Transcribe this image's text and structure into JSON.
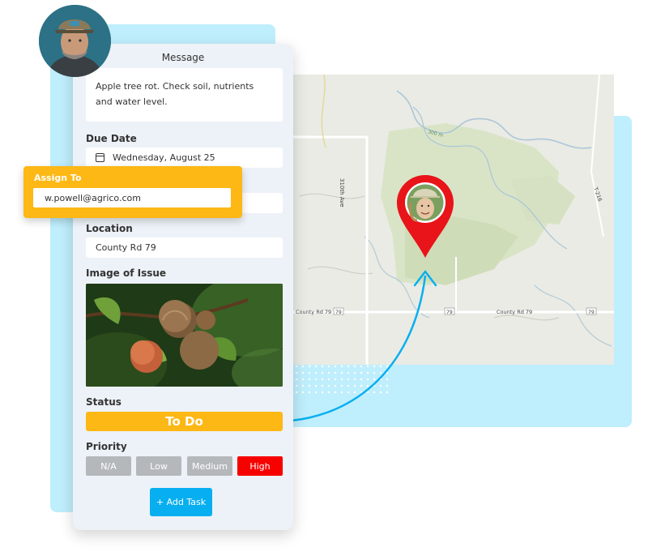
{
  "card": {
    "title": "Message",
    "message": "Apple tree rot. Check soil, nutrients and water level.",
    "due_date_label": "Due Date",
    "due_date_value": "Wednesday, August 25",
    "location_label": "Location",
    "location_value": "County Rd 79",
    "image_label": "Image of Issue",
    "status_label": "Status",
    "status_value": "To Do",
    "priority_label": "Priority",
    "priorities": [
      "N/A",
      "Low",
      "Medium",
      "High"
    ],
    "selected_priority": "High",
    "add_task_label": "+ Add Task"
  },
  "assign": {
    "label": "Assign To",
    "value": "w.powell@agrico.com"
  },
  "map": {
    "labels": {
      "road_vertical": "310th Ave",
      "road_h_left": "County Rd 79",
      "road_h_right": "County Rd 79",
      "shield_1": "79",
      "shield_2": "79",
      "shield_3": "79",
      "contour": "300 m",
      "highway": "T-216"
    }
  },
  "colors": {
    "accent_blue": "#07aff0",
    "status_yellow": "#fdb816",
    "priority_high": "#f70000",
    "pin_red": "#e8141a"
  }
}
